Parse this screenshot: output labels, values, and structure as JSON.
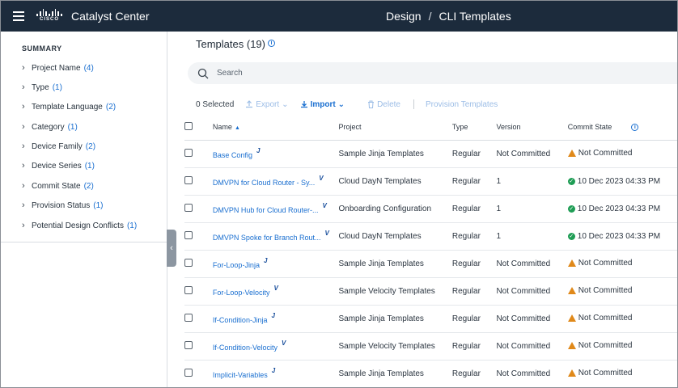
{
  "header": {
    "app_title": "Catalyst Center",
    "logo_text": "CISCO",
    "breadcrumb": [
      "Design",
      "/",
      "CLI Templates"
    ]
  },
  "sidebar": {
    "summary_label": "SUMMARY",
    "filters": [
      {
        "label": "Project Name",
        "count": "(4)"
      },
      {
        "label": "Type",
        "count": "(1)"
      },
      {
        "label": "Template Language",
        "count": "(2)"
      },
      {
        "label": "Category",
        "count": "(1)"
      },
      {
        "label": "Device Family",
        "count": "(2)"
      },
      {
        "label": "Device Series",
        "count": "(1)"
      },
      {
        "label": "Commit State",
        "count": "(2)"
      },
      {
        "label": "Provision Status",
        "count": "(1)"
      },
      {
        "label": "Potential Design Conflicts",
        "count": "(1)"
      }
    ],
    "collapse_icon": "chevron-left-icon"
  },
  "main": {
    "title": "Templates (19)",
    "search_placeholder": "Search",
    "toolbar": {
      "selected": "0 Selected",
      "export_label": "Export",
      "import_label": "Import",
      "delete_label": "Delete",
      "provision_label": "Provision Templates"
    },
    "columns": [
      "Name",
      "Project",
      "Type",
      "Version",
      "Commit State"
    ],
    "rows": [
      {
        "name": "Base Config",
        "lang": "J",
        "project": "Sample Jinja Templates",
        "type": "Regular",
        "version": "Not Committed",
        "commit": "Not Committed",
        "status": "warning"
      },
      {
        "name": "DMVPN for Cloud Router - Sy...",
        "lang": "V",
        "project": "Cloud DayN Templates",
        "type": "Regular",
        "version": "1",
        "commit": "10 Dec 2023 04:33 PM",
        "status": "ok"
      },
      {
        "name": "DMVPN Hub for Cloud Router-...",
        "lang": "V",
        "project": "Onboarding Configuration",
        "type": "Regular",
        "version": "1",
        "commit": "10 Dec 2023 04:33 PM",
        "status": "ok"
      },
      {
        "name": "DMVPN Spoke for Branch Rout...",
        "lang": "V",
        "project": "Cloud DayN Templates",
        "type": "Regular",
        "version": "1",
        "commit": "10 Dec 2023 04:33 PM",
        "status": "ok"
      },
      {
        "name": "For-Loop-Jinja",
        "lang": "J",
        "project": "Sample Jinja Templates",
        "type": "Regular",
        "version": "Not Committed",
        "commit": "Not Committed",
        "status": "warning"
      },
      {
        "name": "For-Loop-Velocity",
        "lang": "V",
        "project": "Sample Velocity Templates",
        "type": "Regular",
        "version": "Not Committed",
        "commit": "Not Committed",
        "status": "warning"
      },
      {
        "name": "If-Condition-Jinja",
        "lang": "J",
        "project": "Sample Jinja Templates",
        "type": "Regular",
        "version": "Not Committed",
        "commit": "Not Committed",
        "status": "warning"
      },
      {
        "name": "If-Condition-Velocity",
        "lang": "V",
        "project": "Sample Velocity Templates",
        "type": "Regular",
        "version": "Not Committed",
        "commit": "Not Committed",
        "status": "warning"
      },
      {
        "name": "Implicit-Variables",
        "lang": "J",
        "project": "Sample Jinja Templates",
        "type": "Regular",
        "version": "Not Committed",
        "commit": "Not Committed",
        "status": "warning"
      }
    ]
  },
  "colors": {
    "topbar": "#1c2b3c",
    "link": "#1a6fd0",
    "ok": "#1f9d55",
    "warning": "#e0891a"
  }
}
